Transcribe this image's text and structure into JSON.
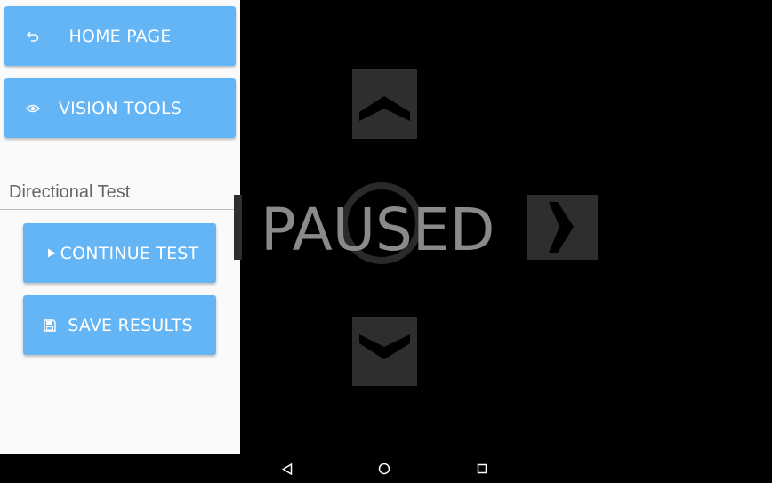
{
  "drawer": {
    "home_label": "HOME PAGE",
    "vision_label": "VISION TOOLS",
    "section_title": "Directional Test",
    "continue_label": "CONTINUE TEST",
    "save_label": "SAVE RESULTS"
  },
  "game": {
    "status_text": "PAUSED"
  },
  "icons": {
    "home": "undo-arrow-icon",
    "vision": "eye-icon",
    "continue": "play-icon",
    "save": "floppy-disk-icon",
    "nav_back": "back-triangle-icon",
    "nav_home": "home-circle-icon",
    "nav_recents": "recents-square-icon"
  },
  "colors": {
    "button_blue": "#64b5f6",
    "drawer_bg": "#fafafa",
    "game_bg": "#000000",
    "arrow_box": "#2e2e2e"
  }
}
